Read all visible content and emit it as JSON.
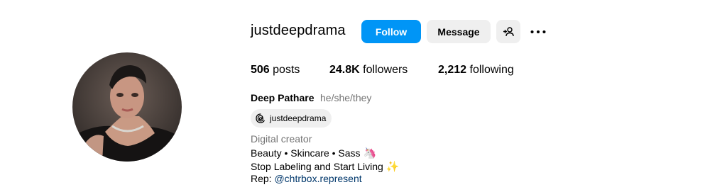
{
  "profile": {
    "username": "justdeepdrama",
    "follow_label": "Follow",
    "message_label": "Message",
    "stats": {
      "posts_count": "506",
      "posts_label": "posts",
      "followers_count": "24.8K",
      "followers_label": "followers",
      "following_count": "2,212",
      "following_label": "following"
    },
    "full_name": "Deep Pathare",
    "pronouns": "he/she/they",
    "threads_handle": "justdeepdrama",
    "category": "Digital creator",
    "bio": {
      "line1": "Beauty • Skincare • Sass",
      "line1_emoji": "🦄",
      "line2": "Stop Labeling and Start Living",
      "line2_emoji": "✨",
      "line3_prefix": "Rep:",
      "line3_link": "@chtrbox.represent"
    }
  },
  "colors": {
    "follow_button": "#0095f6",
    "secondary_button": "#efefef",
    "muted_text": "#737373",
    "link": "#00376b"
  },
  "icons": [
    "avatar-photo",
    "add-person-icon",
    "more-options-icon",
    "threads-icon"
  ]
}
